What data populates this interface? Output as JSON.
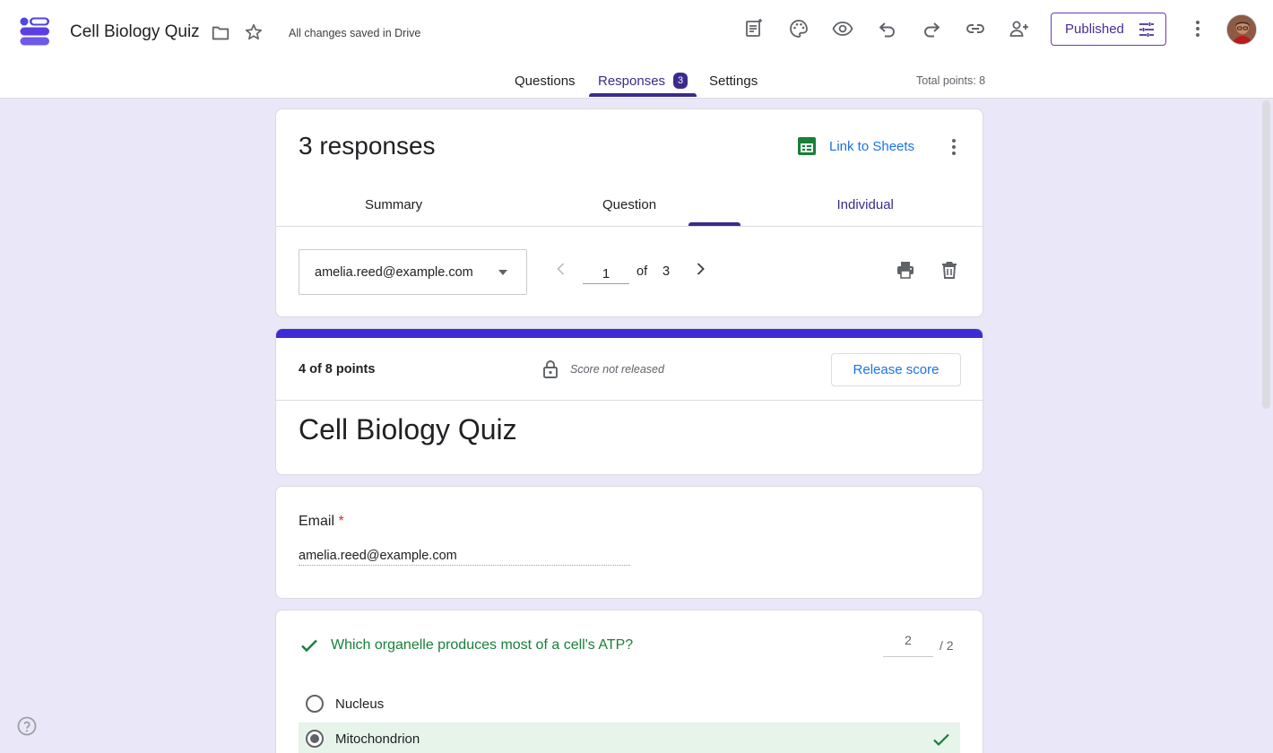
{
  "header": {
    "doc_title": "Cell Biology Quiz",
    "save_status": "All changes saved in Drive",
    "publish_label": "Published",
    "toolbar_icons": [
      "add-on-icon",
      "palette-icon",
      "preview-eye-icon",
      "undo-icon",
      "redo-icon",
      "link-icon",
      "add-collaborator-icon"
    ],
    "tabs": [
      {
        "label": "Questions"
      },
      {
        "label": "Responses",
        "badge": "3",
        "active": true
      },
      {
        "label": "Settings"
      }
    ],
    "total_points": "Total points: 8"
  },
  "responses": {
    "title": "3 responses",
    "link_sheets": "Link to Sheets",
    "subtabs": [
      {
        "label": "Summary"
      },
      {
        "label": "Question"
      },
      {
        "label": "Individual",
        "active": true
      }
    ],
    "selected_email": "amelia.reed@example.com",
    "page_current": "1",
    "page_of": "of",
    "page_total": "3"
  },
  "score": {
    "points": "4 of 8 points",
    "status": "Score not released",
    "release_label": "Release score",
    "quiz_title": "Cell Biology Quiz"
  },
  "email_question": {
    "label": "Email",
    "required_mark": "*",
    "value": "amelia.reed@example.com"
  },
  "question1": {
    "text": "Which organelle produces most of a cell's ATP?",
    "earned": "2",
    "max": "/ 2",
    "options": [
      {
        "label": "Nucleus",
        "selected": false
      },
      {
        "label": "Mitochondrion",
        "selected": true,
        "correct": true
      }
    ]
  },
  "colors": {
    "accent": "#3c2a8c",
    "header_bar": "#3f2ad8",
    "background": "#e9e7f8",
    "correct_green": "#188038",
    "link_blue": "#1a73e8"
  }
}
